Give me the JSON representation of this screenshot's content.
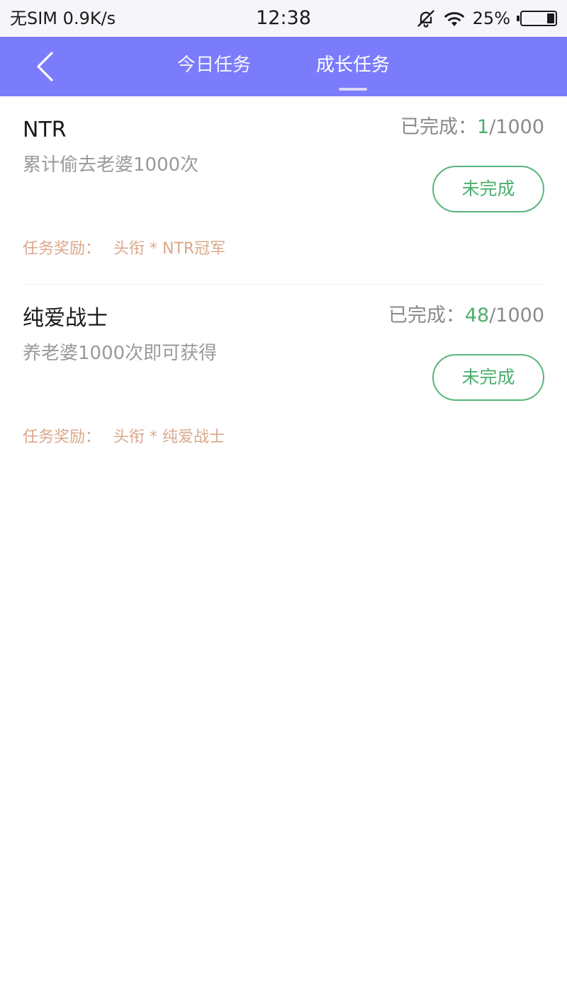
{
  "status_bar": {
    "carrier": "无SIM",
    "speed": "0.9K/s",
    "time": "12:38",
    "battery": "25%",
    "icons": [
      "bell-off-icon",
      "wifi-icon",
      "battery-icon"
    ]
  },
  "header": {
    "back_icon": "chevron-left-icon",
    "tabs": [
      {
        "label": "今日任务",
        "active": false
      },
      {
        "label": "成长任务",
        "active": true
      }
    ]
  },
  "tasks": [
    {
      "title": "NTR",
      "progress_label": "已完成：",
      "progress_current": "1",
      "progress_total": "/1000",
      "description": "累计偷去老婆1000次",
      "status": "未完成",
      "reward_label": "任务奖励：",
      "reward_value": "头衔 * NTR冠军"
    },
    {
      "title": "纯爱战士",
      "progress_label": "已完成：",
      "progress_current": "48",
      "progress_total": "/1000",
      "description": "养老婆1000次即可获得",
      "status": "未完成",
      "reward_label": "任务奖励：",
      "reward_value": "头衔 * 纯爱战士"
    }
  ],
  "colors": {
    "header_bg": "#7b7cfb",
    "accent_green": "#4caf6e",
    "reward_text": "#d9a88c"
  }
}
